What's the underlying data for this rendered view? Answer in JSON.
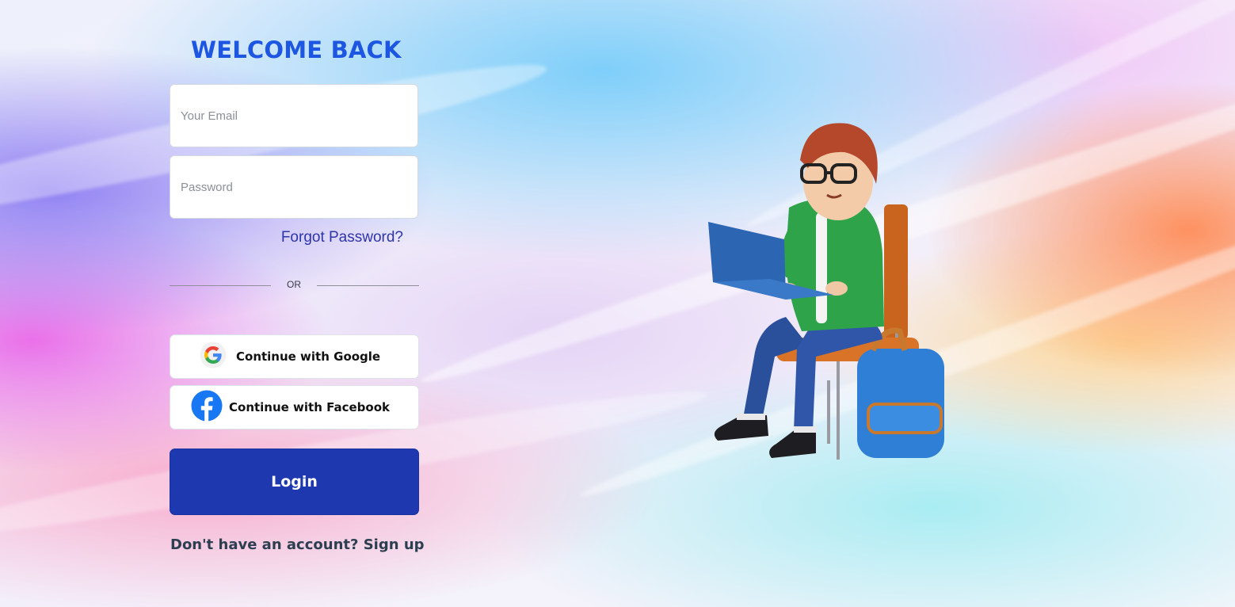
{
  "login_form": {
    "title": "WELCOME BACK",
    "email": {
      "value": "",
      "placeholder": "Your Email"
    },
    "password": {
      "value": "",
      "placeholder": "Password"
    },
    "forgot_password": "Forgot Password?",
    "divider_text": "OR",
    "google_button": {
      "label": "Continue with Google",
      "icon": "google-logo-icon"
    },
    "facebook_button": {
      "label": "Continue with Facebook",
      "icon": "facebook-logo-icon"
    },
    "login_button": "Login",
    "signup_prompt": "Don't have an account?",
    "signup_link": "Sign up"
  },
  "illustration": {
    "subject": "student-with-laptop-illustration"
  },
  "colors": {
    "title": "#1d56e0",
    "primary_button": "#1e38b0",
    "link": "#2e35a8",
    "signup_text": "#2c3e50",
    "facebook": "#1877f2"
  }
}
